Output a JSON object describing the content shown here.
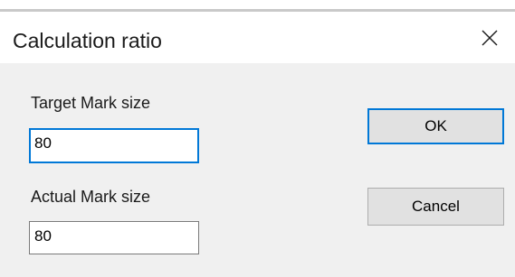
{
  "dialog": {
    "title": "Calculation ratio",
    "target_label": "Target Mark size",
    "target_value": "80",
    "actual_label": "Actual Mark size",
    "actual_value": "80",
    "ok_label": "OK",
    "cancel_label": "Cancel",
    "close_icon": "close-icon"
  },
  "colors": {
    "focus_accent": "#0078d7",
    "dialog_body": "#f0f0f0",
    "button_face": "#e1e1e1"
  }
}
